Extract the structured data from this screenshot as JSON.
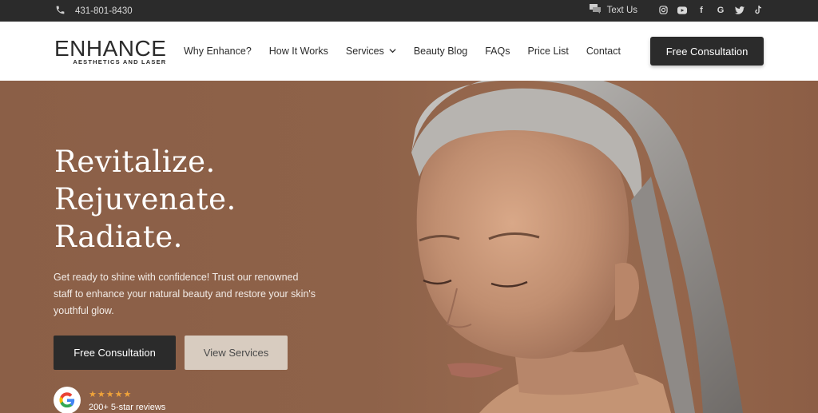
{
  "topbar": {
    "phone": "431-801-8430",
    "text_us": "Text Us",
    "social_icons": [
      "instagram-icon",
      "youtube-icon",
      "facebook-icon",
      "google-icon",
      "twitter-icon",
      "tiktok-icon"
    ]
  },
  "header": {
    "logo_main": "ENHANCE",
    "logo_sub": "AESTHETICS AND LASER",
    "nav": [
      {
        "label": "Why Enhance?"
      },
      {
        "label": "How It Works"
      },
      {
        "label": "Services"
      },
      {
        "label": "Beauty Blog"
      },
      {
        "label": "FAQs"
      },
      {
        "label": "Price List"
      },
      {
        "label": "Contact"
      }
    ],
    "cta": "Free Consultation"
  },
  "hero": {
    "headline": [
      "Revitalize.",
      "Rejuvenate.",
      "Radiate."
    ],
    "subtext": "Get ready to shine with confidence! Trust our renowned staff to enhance your natural beauty and restore your skin's youthful glow.",
    "primary_button": "Free Consultation",
    "secondary_button": "View Services",
    "stars": "★★★★★",
    "reviews": "200+ 5-star reviews"
  },
  "colors": {
    "dark": "#2b2b2b",
    "hero_bg": "#8b5f47",
    "light_button": "#d8ccc0",
    "star": "#f0a33a"
  }
}
